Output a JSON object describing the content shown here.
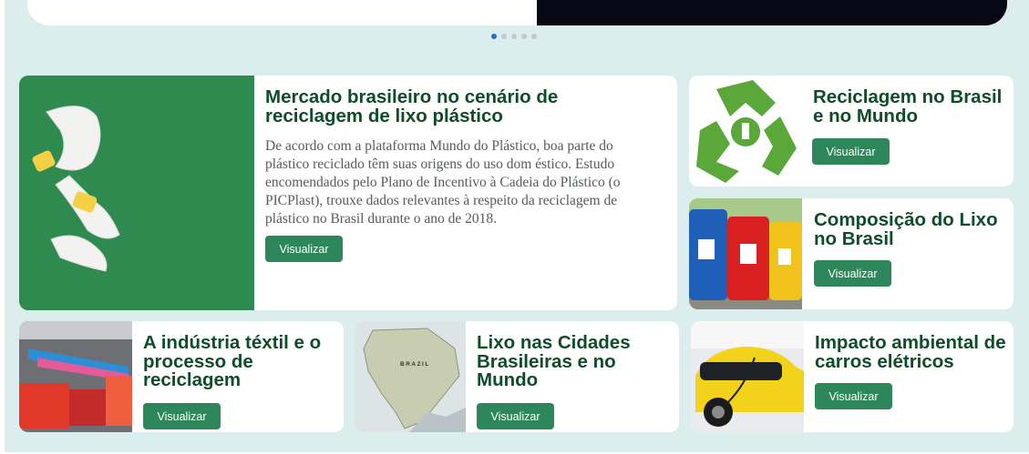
{
  "carousel": {
    "dot_count": 5,
    "active_index": 0
  },
  "cards": {
    "main": {
      "title": "Mercado brasileiro no cenário de reciclagem de lixo plástico",
      "description": "De acordo com a plataforma Mundo do Plástico, boa parte do plástico reciclado têm suas origens do uso dom éstico. Estudo encomendados pelo Plano de Incentivo à Cadeia do Plástico (o PICPlast), trouxe dados relevantes à respeito da reciclagem de plástico no Brasil durante o ano de 2018.",
      "button": "Visualizar"
    },
    "reciclagem": {
      "title": "Reciclagem no Brasil e no Mundo",
      "button": "Visualizar"
    },
    "composicao": {
      "title": "Composição do Lixo no Brasil",
      "button": "Visualizar"
    },
    "textil": {
      "title": "A indústria téxtil e o processo de reciclagem",
      "button": "Visualizar"
    },
    "cidades": {
      "title": "Lixo nas Cidades Brasileiras e no Mundo",
      "button": "Visualizar",
      "map_label": "BRAZIL"
    },
    "carros": {
      "title": "Impacto ambiental de carros elétricos",
      "button": "Visualizar"
    }
  },
  "colors": {
    "accent": "#2e875a",
    "title": "#0f4d2a",
    "background": "#dcedee"
  }
}
